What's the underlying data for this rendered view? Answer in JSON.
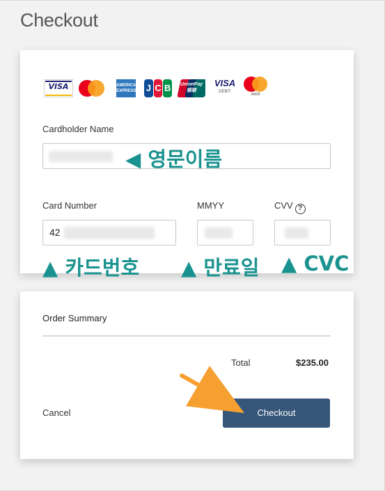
{
  "page": {
    "title": "Checkout"
  },
  "payment": {
    "brands": [
      {
        "name": "visa-icon",
        "label": "VISA"
      },
      {
        "name": "mastercard-icon"
      },
      {
        "name": "amex-icon",
        "label": "AMERICAN EXPRESS"
      },
      {
        "name": "jcb-icon",
        "label": "JCB"
      },
      {
        "name": "unionpay-icon",
        "label": "UnionPay 银联"
      },
      {
        "name": "visa-debit-icon",
        "label": "VISA",
        "sub": "DEBIT"
      },
      {
        "name": "mastercard-debit-icon",
        "sub": "debit"
      }
    ],
    "cardholder_label": "Cardholder Name",
    "card_number_label": "Card Number",
    "card_number_value": "42",
    "expiry_label": "MMYY",
    "cvv_label": "CVV",
    "cvv_help_icon": "?"
  },
  "annotations": {
    "name": "◀ 영문이름",
    "card_number": "▲ 카드번호",
    "expiry": "▲ 만료일",
    "cvc": "▲ CVC"
  },
  "summary": {
    "title": "Order Summary",
    "total_label": "Total",
    "total_value": "$235.00",
    "cancel_label": "Cancel",
    "checkout_label": "Checkout"
  },
  "colors": {
    "accent": "#36567a",
    "annotation": "#1a9390",
    "arrow": "#f5a030"
  }
}
